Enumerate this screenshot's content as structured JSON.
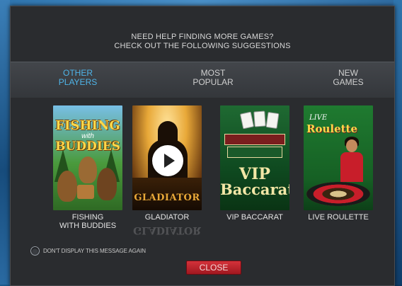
{
  "dialog": {
    "headline_line1": "NEED HELP FINDING MORE GAMES?",
    "headline_line2": "CHECK OUT THE FOLLOWING SUGGESTIONS"
  },
  "tabs": [
    {
      "line1": "OTHER",
      "line2": "PLAYERS",
      "active": true
    },
    {
      "line1": "MOST",
      "line2": "POPULAR",
      "active": false
    },
    {
      "line1": "NEW",
      "line2": "GAMES",
      "active": false
    }
  ],
  "games": [
    {
      "caption_line1": "FISHING",
      "caption_line2": "WITH BUDDIES",
      "art_title_1": "FISHING",
      "art_subtitle": "with",
      "art_title_2": "BUDDIES"
    },
    {
      "caption_line1": "GLADIATOR",
      "art_title": "GLADIATOR",
      "icon": "play-icon"
    },
    {
      "caption_line1": "VIP BACCARAT",
      "art_title_1": "VIP",
      "art_title_2": "Baccarat"
    },
    {
      "caption_line1": "LIVE ROULETTE",
      "art_subtitle": "LIVE",
      "art_title": "Roulette"
    }
  ],
  "footer": {
    "option_label": "DON'T DISPLAY THIS MESSAGE AGAIN",
    "close_label": "CLOSE"
  },
  "colors": {
    "accent_tab": "#4fb4e8",
    "close_button": "#c02830",
    "dialog_bg": "#2a2c2f"
  }
}
